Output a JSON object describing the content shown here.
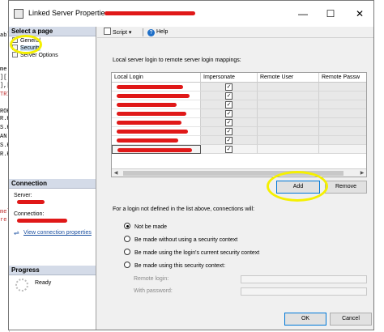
{
  "background_editor": {
    "lines": [
      "able",
      "me",
      "][",
      "],[",
      "TRI",
      "ROK",
      "R.K",
      "S.K",
      "AN",
      "S.K",
      "R.K",
      "mel",
      "re"
    ]
  },
  "window": {
    "title": "Linked Server Properties - ",
    "minimize_glyph": "—",
    "maximize_glyph": "☐",
    "close_glyph": "✕"
  },
  "left": {
    "select_page_header": "Select a page",
    "pages": [
      {
        "label": "General",
        "selected": false
      },
      {
        "label": "Security",
        "selected": true
      },
      {
        "label": "Server Options",
        "selected": false
      }
    ],
    "connection_header": "Connection",
    "server_label": "Server:",
    "connection_label": "Connection:",
    "view_props_link": "View connection properties",
    "progress_header": "Progress",
    "status": "Ready"
  },
  "toolbar": {
    "script_label": "Script",
    "dropdown_glyph": "▾",
    "help_label": "Help"
  },
  "mappings": {
    "caption": "Local server login to remote server login mappings:",
    "columns": [
      "Local Login",
      "Impersonate",
      "Remote User",
      "Remote Passw"
    ],
    "rows": [
      {
        "impersonate": true,
        "selected": false
      },
      {
        "impersonate": true,
        "selected": false
      },
      {
        "impersonate": true,
        "selected": false
      },
      {
        "impersonate": true,
        "selected": false
      },
      {
        "impersonate": true,
        "selected": false
      },
      {
        "impersonate": true,
        "selected": false
      },
      {
        "impersonate": true,
        "selected": false
      },
      {
        "impersonate": true,
        "selected": true
      }
    ],
    "check_glyph": "✓",
    "scroll_left": "◀",
    "scroll_right": "▶"
  },
  "buttons": {
    "add": "Add",
    "remove": "Remove",
    "ok": "OK",
    "cancel": "Cancel"
  },
  "not_defined": {
    "caption": "For a login not defined in the list above, connections will:",
    "options": [
      {
        "label": "Not be made",
        "selected": true
      },
      {
        "label": "Be made without using a security context",
        "selected": false
      },
      {
        "label": "Be made using the login's current security context",
        "selected": false
      },
      {
        "label": "Be made using this security context:",
        "selected": false
      }
    ],
    "remote_login_label": "Remote login:",
    "password_label": "With password:"
  },
  "colors": {
    "highlight": "#f5f000",
    "redaction": "#e01818",
    "accent": "#0078d7"
  }
}
